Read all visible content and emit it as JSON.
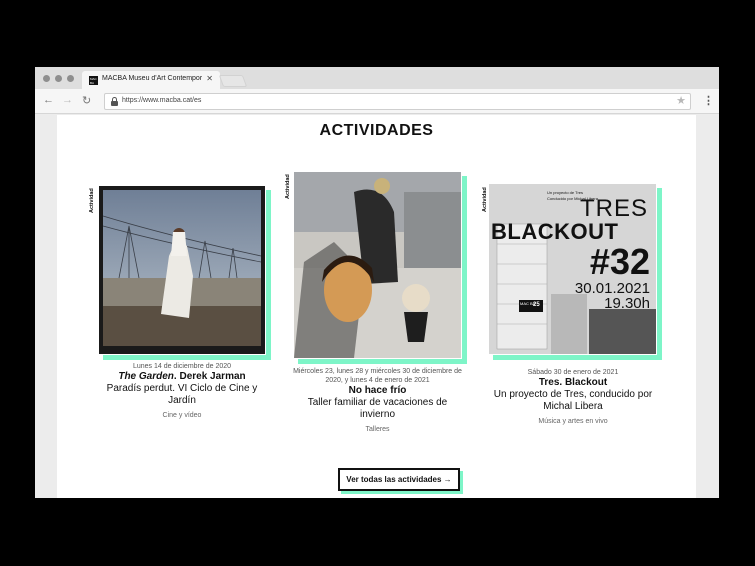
{
  "browser": {
    "tab_title": "MACBA Museu d'Art Contempora",
    "tab_close": "✕",
    "favicon_text": "MAC BA",
    "url": "https://www.macba.cat/es",
    "back": "←",
    "forward": "→",
    "reload": "↻",
    "star": "★",
    "menu": "⋮"
  },
  "page": {
    "title": "ACTIVIDADES",
    "cta": "Ver todas las actividades →"
  },
  "cards": [
    {
      "label": "Actividad",
      "date": "Lunes 14 de diciembre de 2020",
      "name_italic": "The Garden",
      "name_rest": ". Derek Jarman",
      "subtitle": "Paradís perdut. VI Ciclo de Cine y Jardín",
      "category": "Cine y vídeo"
    },
    {
      "label": "Actividad",
      "date": "Miércoles 23, lunes 28 y miércoles 30 de diciembre de 2020, y lunes 4 de enero de 2021",
      "name": "No hace frío",
      "subtitle": "Taller familiar de vacaciones de invierno",
      "category": "Talleres"
    },
    {
      "label": "Actividad",
      "date": "Sábado 30 de enero de 2021",
      "name": "Tres. Blackout",
      "subtitle": "Un proyecto de Tres, conducido por Michal Libera",
      "category": "Música y artes en vivo",
      "poster": {
        "small_top_1": "Un proyecto de Tres",
        "small_top_2": "Conducido por Michal Libera",
        "line1": "TRES",
        "line2": "BLACKOUT",
        "line3": "#32",
        "line4": "30.01.2021",
        "line5": "19.30h",
        "logo": "MAC BA",
        "badge": "25"
      }
    }
  ],
  "colors": {
    "accent": "#7ef5c8",
    "text": "#111111"
  }
}
